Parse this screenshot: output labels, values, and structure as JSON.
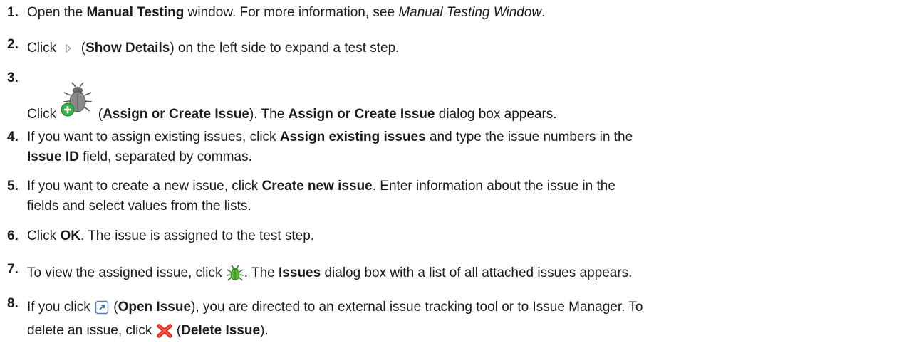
{
  "steps": [
    {
      "number": "1.",
      "parts": [
        "Open the ",
        "Manual Testing",
        " window. For more information, see ",
        "Manual Testing Window",
        "."
      ]
    },
    {
      "number": "2.",
      "parts": [
        "Click ",
        " (",
        "Show Details",
        ") on the left side to expand a test step."
      ],
      "icon": "triangle-right-icon"
    },
    {
      "number": "3.",
      "parts": [
        "Click ",
        " (",
        "Assign or Create Issue",
        "). The ",
        "Assign or Create Issue",
        " dialog box appears."
      ],
      "icon": "bug-add-icon"
    },
    {
      "number": "4.",
      "parts": [
        "If you want to assign existing issues, click ",
        "Assign existing issues",
        " and type the issue numbers in the",
        "Issue ID",
        " field, separated by commas."
      ]
    },
    {
      "number": "5.",
      "parts": [
        "If you want to create a new issue, click ",
        "Create new issue",
        ". Enter information about the issue in the",
        "fields and select values from the lists."
      ]
    },
    {
      "number": "6.",
      "parts": [
        "Click ",
        "OK",
        ". The issue is assigned to the test step."
      ]
    },
    {
      "number": "7.",
      "parts": [
        "To view the assigned issue, click ",
        ". The ",
        "Issues",
        " dialog box with a list of all attached issues appears."
      ],
      "icon": "green-bug-icon"
    },
    {
      "number": "8.",
      "parts": [
        "If you click ",
        " (",
        "Open Issue",
        "), you are directed to an external issue tracking tool or to Issue Manager. To",
        "delete an issue, click ",
        " (",
        "Delete Issue",
        ")."
      ],
      "icons": [
        "open-external-icon",
        "red-x-icon"
      ]
    }
  ]
}
